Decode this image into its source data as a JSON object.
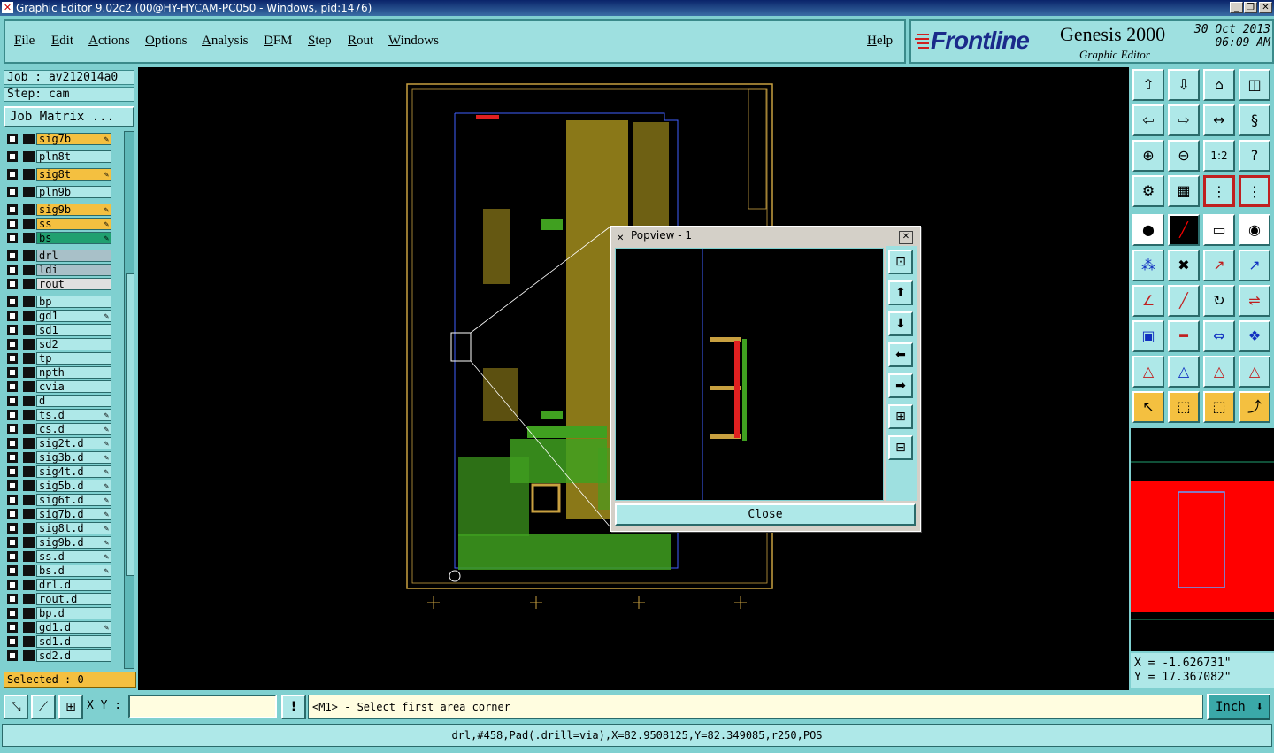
{
  "window": {
    "title": "Graphic Editor 9.02c2 (00@HY-HYCAM-PC050 - Windows, pid:1476)"
  },
  "menu": [
    "File",
    "Edit",
    "Actions",
    "Options",
    "Analysis",
    "DFM",
    "Step",
    "Rout",
    "Windows"
  ],
  "help_label": "Help",
  "brand": {
    "logo": "Frontline",
    "product": "Genesis 2000",
    "subtitle": "Graphic Editor",
    "date": "30 Oct 2013",
    "time": "06:09 AM"
  },
  "job": {
    "job_label": "Job : av212014a0",
    "step_label": "Step: cam",
    "matrix_button": "Job Matrix ..."
  },
  "layers": [
    {
      "name": "sig7b",
      "color": "#f4c040",
      "pen": true
    },
    {
      "name": "pln8t",
      "color": "#aee8e8",
      "pen": false
    },
    {
      "name": "sig8t",
      "color": "#f4c040",
      "pen": true
    },
    {
      "name": "pln9b",
      "color": "#aee8e8",
      "pen": false
    },
    {
      "name": "sig9b",
      "color": "#f4c040",
      "pen": true
    },
    {
      "name": "ss",
      "color": "#f4c040",
      "pen": true
    },
    {
      "name": "bs",
      "color": "#20a070",
      "pen": true
    },
    {
      "name": "drl",
      "color": "#a8c0c8",
      "pen": false
    },
    {
      "name": "ldi",
      "color": "#a8c0c8",
      "pen": false
    },
    {
      "name": "rout",
      "color": "#e0e0e0",
      "pen": false
    },
    {
      "name": "bp",
      "color": "#aee8e8",
      "pen": false
    },
    {
      "name": "gd1",
      "color": "#aee8e8",
      "pen": true
    },
    {
      "name": "sd1",
      "color": "#aee8e8",
      "pen": false
    },
    {
      "name": "sd2",
      "color": "#aee8e8",
      "pen": false
    },
    {
      "name": "tp",
      "color": "#aee8e8",
      "pen": false
    },
    {
      "name": "npth",
      "color": "#aee8e8",
      "pen": false
    },
    {
      "name": "cvia",
      "color": "#aee8e8",
      "pen": false
    },
    {
      "name": "d",
      "color": "#aee8e8",
      "pen": false
    },
    {
      "name": "ts.d",
      "color": "#aee8e8",
      "pen": true
    },
    {
      "name": "cs.d",
      "color": "#aee8e8",
      "pen": true
    },
    {
      "name": "sig2t.d",
      "color": "#aee8e8",
      "pen": true
    },
    {
      "name": "sig3b.d",
      "color": "#aee8e8",
      "pen": true
    },
    {
      "name": "sig4t.d",
      "color": "#aee8e8",
      "pen": true
    },
    {
      "name": "sig5b.d",
      "color": "#aee8e8",
      "pen": true
    },
    {
      "name": "sig6t.d",
      "color": "#aee8e8",
      "pen": true
    },
    {
      "name": "sig7b.d",
      "color": "#aee8e8",
      "pen": true
    },
    {
      "name": "sig8t.d",
      "color": "#aee8e8",
      "pen": true
    },
    {
      "name": "sig9b.d",
      "color": "#aee8e8",
      "pen": true
    },
    {
      "name": "ss.d",
      "color": "#aee8e8",
      "pen": true
    },
    {
      "name": "bs.d",
      "color": "#aee8e8",
      "pen": true
    },
    {
      "name": "drl.d",
      "color": "#aee8e8",
      "pen": false
    },
    {
      "name": "rout.d",
      "color": "#aee8e8",
      "pen": false
    },
    {
      "name": "bp.d",
      "color": "#aee8e8",
      "pen": false
    },
    {
      "name": "gd1.d",
      "color": "#aee8e8",
      "pen": true
    },
    {
      "name": "sd1.d",
      "color": "#aee8e8",
      "pen": false
    },
    {
      "name": "sd2.d",
      "color": "#aee8e8",
      "pen": false
    }
  ],
  "selected_label": "Selected : 0",
  "popview": {
    "title": "Popview - 1",
    "close_button": "Close"
  },
  "coords": {
    "x": "X = -1.626731\"",
    "y": "Y = 17.367082\""
  },
  "cmd": {
    "xy_label": "X Y :",
    "xy_value": "",
    "prompt": "<M1> - Select first area corner",
    "unit": "Inch"
  },
  "status_text": "drl,#458,Pad(.drill=via),X=82.9508125,Y=82.349085,r250,POS"
}
